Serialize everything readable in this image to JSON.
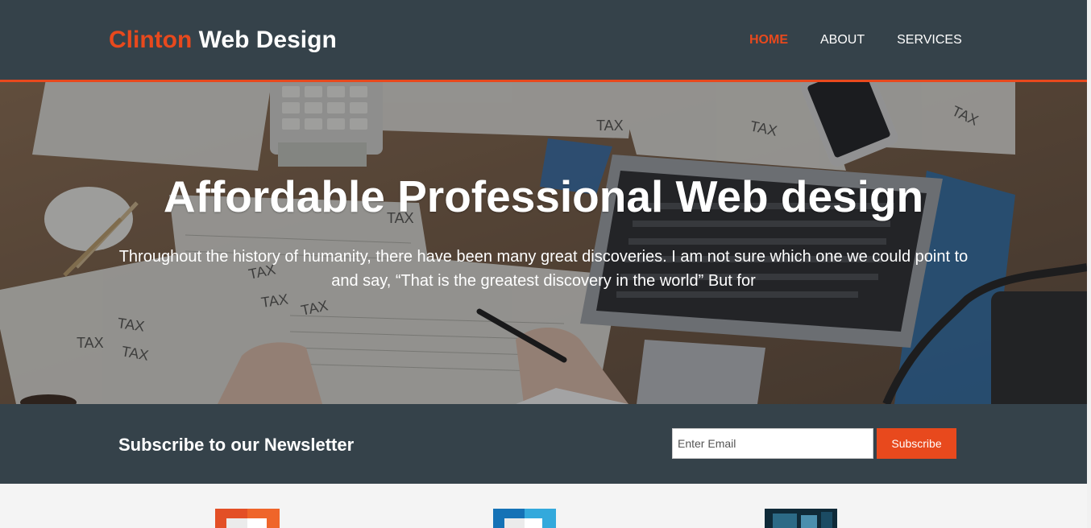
{
  "header": {
    "brand_highlight": "Clinton",
    "brand_rest": " Web Design",
    "nav": [
      {
        "label": "HOME",
        "current": true
      },
      {
        "label": "ABOUT",
        "current": false
      },
      {
        "label": "SERVICES",
        "current": false
      }
    ]
  },
  "showcase": {
    "title": "Affordable Professional Web design",
    "text": "Throughout the history of humanity, there have been many great discoveries. I am not sure which one we could point to and say, “That is the greatest discovery in the world” But for",
    "image_icons": [
      "calculator-icon",
      "laptop-icon",
      "phone-icon",
      "pen-icon",
      "tax-document-icon"
    ]
  },
  "newsletter": {
    "heading": "Subscribe to our Newsletter",
    "email_placeholder": "Enter Email",
    "email_value": "",
    "button_label": "Subscribe"
  },
  "boxes": {
    "icons": [
      "html5-logo-icon",
      "css3-logo-icon",
      "brand-logo-icon"
    ]
  },
  "colors": {
    "dark": "#35424a",
    "accent": "#e8491d",
    "light": "#f4f4f4"
  }
}
